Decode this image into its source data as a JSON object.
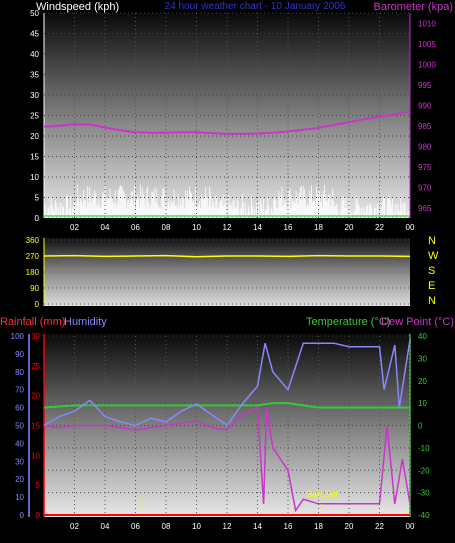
{
  "header": {
    "left_label": "Windspeed (kph)",
    "center_label": "24 hour weather chart - 10 January 2006",
    "right_label": "Barometer (kpa)"
  },
  "bottom_header": {
    "rain_label": "Rainfall (mm)",
    "humidity_label": "Humidity",
    "temp_label": "Temperature (°C)",
    "dew_label": "Dew Point (°C)"
  },
  "sunset_label": "Sun Set",
  "compass": [
    "N",
    "W",
    "S",
    "E",
    "N"
  ],
  "colors": {
    "wind": "#ffffff",
    "gust": "#00cc00",
    "baro": "#cc33cc",
    "direction": "#ffff00",
    "rain": "#ff0000",
    "humidity": "#8888ff",
    "temperature": "#33cc33",
    "dewpoint": "#cc33cc",
    "sunset": "#ffff00"
  },
  "chart_data": [
    {
      "type": "line",
      "title": "24 hour weather chart - 10 January 2006",
      "x_ticks": [
        "02",
        "04",
        "06",
        "08",
        "10",
        "12",
        "14",
        "16",
        "18",
        "20",
        "22",
        "00"
      ],
      "y_left_label": "Windspeed (kph)",
      "y_left_ticks": [
        0,
        5,
        10,
        15,
        20,
        25,
        30,
        35,
        40,
        45,
        50
      ],
      "y_right_label": "Barometer (kpa)",
      "y_right_ticks": [
        965,
        970,
        975,
        980,
        985,
        990,
        995,
        1000,
        1005,
        1010
      ],
      "y_right_lim": [
        962.5,
        1012.5
      ],
      "series": [
        {
          "name": "Barometer (kpa)",
          "x": [
            0,
            1,
            2,
            3,
            4,
            5,
            6,
            7,
            8,
            9,
            10,
            11,
            12,
            13,
            14,
            15,
            16,
            17,
            18,
            19,
            20,
            21,
            22,
            23,
            24
          ],
          "values": [
            984.8,
            985.0,
            985.4,
            985.3,
            984.6,
            983.9,
            983.4,
            983.3,
            983.3,
            983.4,
            983.4,
            983.2,
            983.0,
            983.0,
            983.1,
            983.3,
            983.6,
            984.0,
            984.5,
            985.2,
            985.9,
            986.6,
            987.2,
            987.8,
            988.5
          ]
        }
      ]
    },
    {
      "type": "line",
      "title": "",
      "x_ticks": [
        "02",
        "04",
        "06",
        "08",
        "10",
        "12",
        "14",
        "16",
        "18",
        "20",
        "22",
        "00"
      ],
      "y_ticks": [
        0,
        90,
        180,
        270,
        360
      ],
      "y_right_labels": [
        "N",
        "W",
        "S",
        "E",
        "N"
      ],
      "series": [
        {
          "name": "",
          "x": [
            0,
            2,
            4,
            6,
            8,
            10,
            12,
            14,
            16,
            18,
            20,
            22,
            24
          ],
          "values": [
            270,
            272,
            268,
            270,
            272,
            266,
            270,
            270,
            268,
            272,
            270,
            270,
            268
          ]
        }
      ]
    },
    {
      "type": "line",
      "title": "",
      "x_ticks": [
        "02",
        "04",
        "06",
        "08",
        "10",
        "12",
        "14",
        "16",
        "18",
        "20",
        "22",
        "00"
      ],
      "y_left_ticks": [
        0,
        10,
        20,
        30,
        40,
        50,
        60,
        70,
        80,
        90,
        100
      ],
      "y_rain_ticks": [
        0,
        5,
        10,
        15,
        20,
        25,
        30
      ],
      "y_right_ticks": [
        -40,
        -30,
        -20,
        -10,
        0,
        10,
        20,
        30,
        40
      ],
      "series": [
        {
          "name": "Humidity",
          "x": [
            0,
            1,
            2,
            3,
            4,
            5,
            6,
            7,
            8,
            9,
            10,
            11,
            12,
            13,
            14,
            14.5,
            15,
            16,
            17,
            17.3,
            18,
            19,
            20,
            21,
            22,
            22.3,
            23,
            23.3,
            24
          ],
          "values": [
            50,
            55,
            58,
            64,
            55,
            52,
            50,
            54,
            52,
            58,
            62,
            56,
            50,
            62,
            72,
            96,
            80,
            70,
            96,
            96,
            96,
            96,
            94,
            94,
            94,
            70,
            95,
            60,
            98
          ]
        },
        {
          "name": "Temperature (°C)",
          "x": [
            0,
            2,
            4,
            6,
            8,
            10,
            12,
            14,
            15,
            16,
            17,
            18,
            20,
            22,
            24
          ],
          "values": [
            8,
            9,
            9,
            9,
            9,
            9,
            9,
            9,
            10,
            10,
            9,
            8,
            8,
            8,
            8
          ]
        },
        {
          "name": "Dew Point (°C)",
          "x": [
            0,
            1,
            2,
            3,
            4,
            5,
            6,
            7,
            8,
            9,
            10,
            11,
            12,
            13,
            14,
            14.4,
            14.6,
            15,
            16,
            16.5,
            17,
            18,
            20,
            21,
            22,
            22.5,
            23,
            23.5,
            24
          ],
          "values": [
            0,
            -1,
            0,
            0,
            0,
            -1,
            -2,
            -1,
            0,
            1,
            2,
            -1,
            -2,
            5,
            8,
            -35,
            8,
            -10,
            -20,
            -38,
            -33,
            -35,
            -35,
            -35,
            -35,
            0,
            -35,
            -15,
            -35
          ]
        },
        {
          "name": "Rainfall (mm)",
          "x": [
            0,
            24
          ],
          "values": [
            0,
            0
          ]
        }
      ],
      "annotations": [
        "Sun Set"
      ]
    }
  ]
}
